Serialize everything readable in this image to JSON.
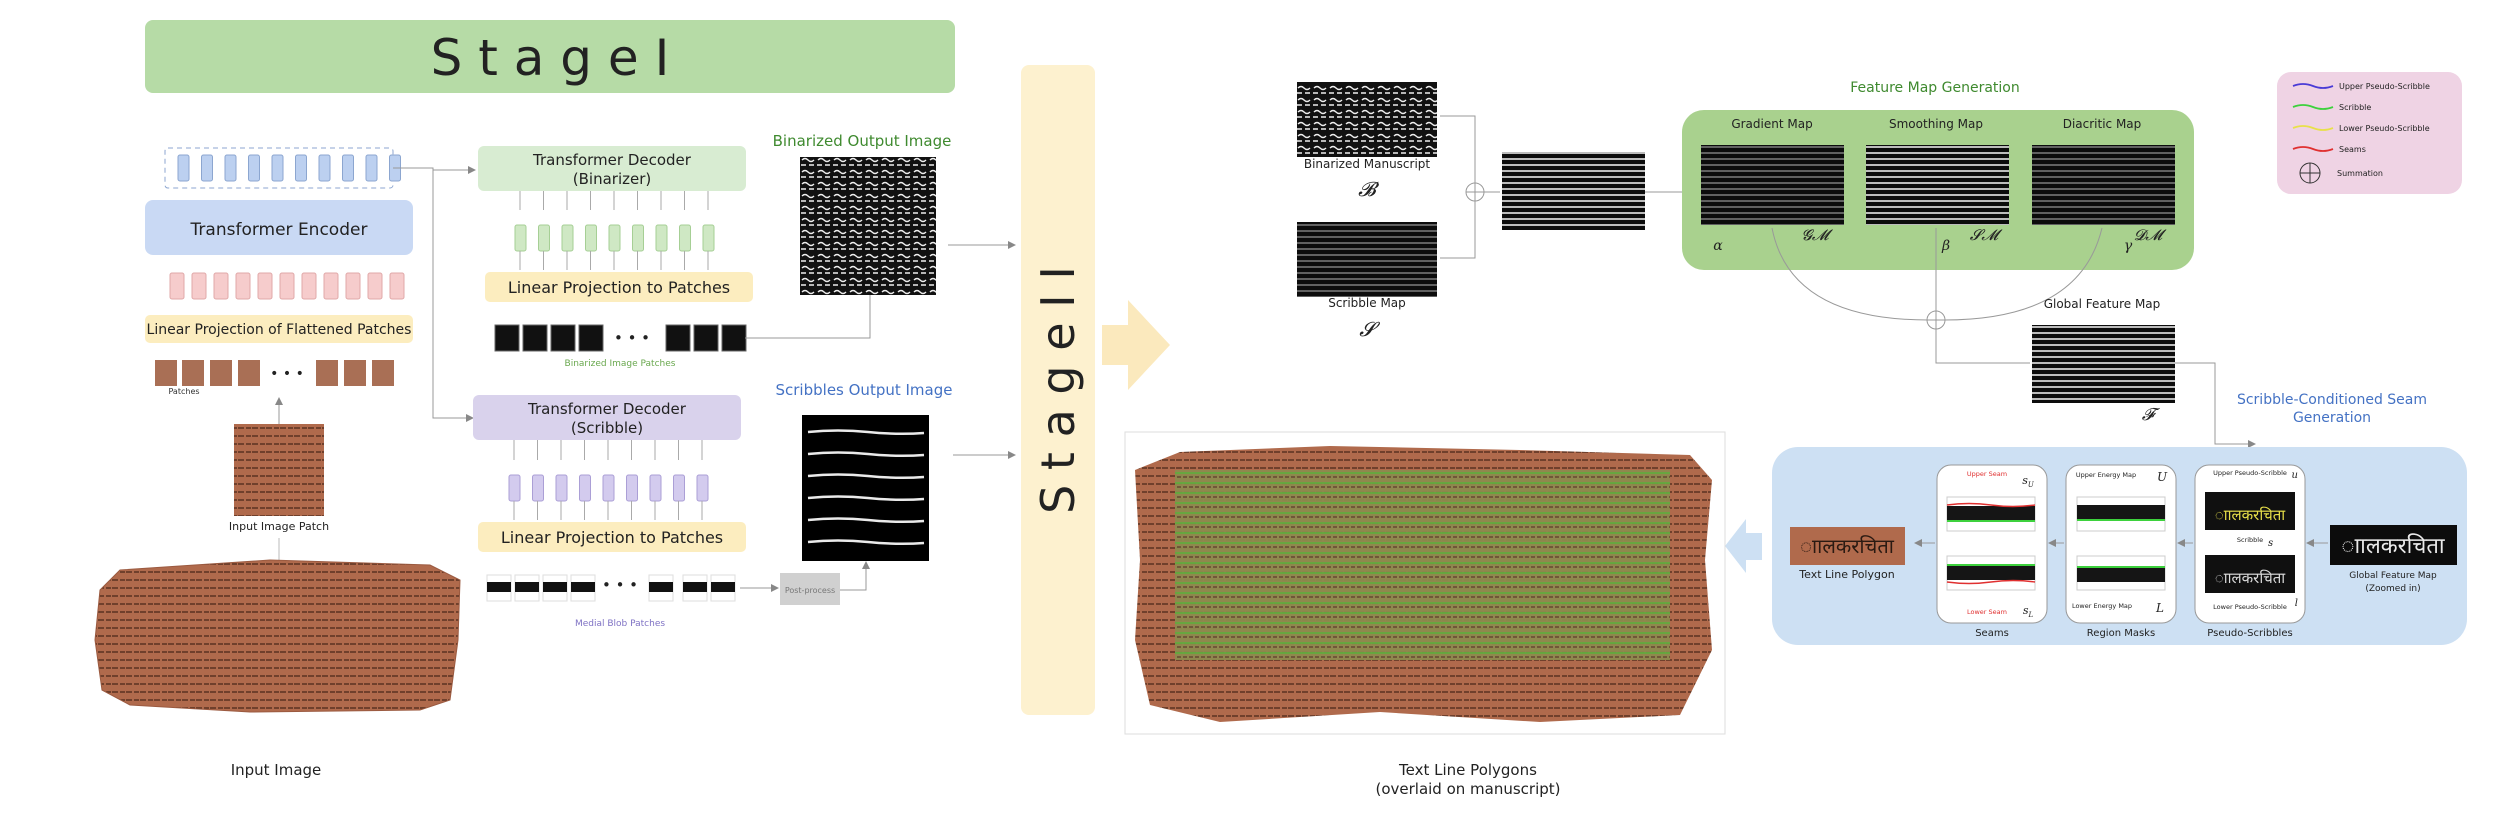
{
  "stage1": {
    "title": "S t a g e I",
    "encoder": "Transformer Encoder",
    "linear_flat": "Linear Projection of Flattened Patches",
    "patches_label": "Patches",
    "input_patch_label": "Input Image Patch",
    "input_image_label": "Input Image",
    "decoder_binarizer_l1": "Transformer Decoder",
    "decoder_binarizer_l2": "(Binarizer)",
    "linear_proj_binarizer": "Linear Projection to Patches",
    "binarized_patches_label": "Binarized Image Patches",
    "binarized_output_label": "Binarized Output Image",
    "decoder_scribble_l1": "Transformer Decoder",
    "decoder_scribble_l2": "(Scribble)",
    "linear_proj_scribble": "Linear Projection to Patches",
    "medial_blob_label": "Medial Blob Patches",
    "scribbles_output_label": "Scribbles Output Image",
    "post_process": "Post-process",
    "dots": "• • •"
  },
  "stage2": {
    "title": "S t a g e I I",
    "binarized_manuscript": "Binarized Manuscript",
    "sym_B": "𝓑",
    "scribble_map": "Scribble Map",
    "sym_S": "𝓢",
    "feature_map_generation": "Feature Map Generation",
    "gradient_map": "Gradient Map",
    "smoothing_map": "Smoothing Map",
    "diacritic_map": "Diacritic Map",
    "sym_GM": "𝓖𝓜",
    "sym_SM": "𝓢𝓜",
    "sym_DM": "𝓓𝓜",
    "alpha": "α",
    "beta": "β",
    "gamma": "γ",
    "global_feature_map": "Global Feature Map",
    "sym_F": "𝓕",
    "seam_gen_l1": "Scribble-Conditioned Seam",
    "seam_gen_l2": "Generation",
    "text_line_polygon": "Text Line Polygon",
    "seams": "Seams",
    "region_masks": "Region Masks",
    "pseudo_scribbles": "Pseudo-Scribbles",
    "upper_seam": "Upper Seam",
    "lower_seam": "Lower Seam",
    "sym_su": "s",
    "sym_su_sub": "U",
    "sym_sl": "s",
    "sym_sl_sub": "L",
    "upper_energy_map": "Upper Energy Map",
    "lower_energy_map": "Lower Energy Map",
    "sym_U": "U",
    "sym_L": "L",
    "upper_pseudo": "Upper Pseudo-Scribble",
    "scribble_inner": "Scribble",
    "lower_pseudo": "Lower Pseudo-Scribble",
    "sym_u": "u",
    "sym_s": "s",
    "sym_l": "l",
    "gfm_zoomed_l1": "Global Feature Map",
    "gfm_zoomed_l2": "(Zoomed in)",
    "text_line_polygons_l1": "Text Line Polygons",
    "text_line_polygons_l2": "(overlaid on manuscript)",
    "script_sample": "ाालकरचिता"
  },
  "legend": {
    "items": [
      {
        "label": "Upper Pseudo-Scribble",
        "color": "#4a3bd6"
      },
      {
        "label": "Scribble",
        "color": "#3dd13d"
      },
      {
        "label": "Lower Pseudo-Scribble",
        "color": "#e8e04a"
      },
      {
        "label": "Seams",
        "color": "#e03030"
      }
    ],
    "summation": "Summation"
  },
  "colors": {
    "stage1_header": "#b6dba6",
    "encoder": "#c9d9f4",
    "linear_yellow": "#fcedbf",
    "decoder_bin": "#d8ecd2",
    "decoder_scr": "#d9d2ec",
    "stage2_box": "#fdf1cf",
    "feature_green": "#a9d18e",
    "seam_blue": "#cde0f3",
    "legend_pink": "#efd3e4",
    "green_label": "#3f8a2f",
    "blue_label": "#4472c4",
    "purple_label": "#7f72c4"
  }
}
